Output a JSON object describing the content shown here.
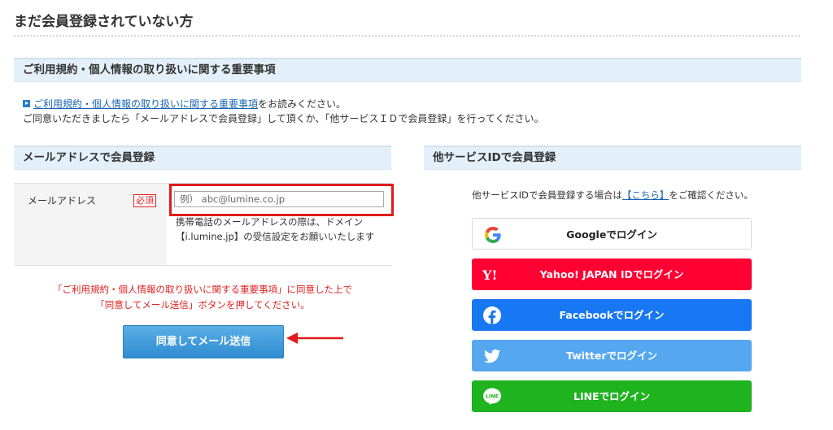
{
  "page_title": "まだ会員登録されていない方",
  "notice": {
    "heading": "ご利用規約・個人情報の取り扱いに関する重要事項",
    "link_text": "ご利用規約・個人情報の取り扱いに関する重要事項",
    "line1_suffix": "をお読みください。",
    "line2": "ご同意いただきましたら「メールアドレスで会員登録」して頂くか、「他サービスＩＤで会員登録」を行ってください。"
  },
  "mail_section": {
    "heading": "メールアドレスで会員登録",
    "field_label": "メールアドレス",
    "required_label": "必須",
    "input_value": "",
    "input_placeholder": "例） abc@lumine.co.jp",
    "note": "携帯電話のメールアドレスの際は、ドメイン【i.lumine.jp】の受信設定をお願いいたします",
    "agree_line1": "「ご利用規約・個人情報の取り扱いに関する重要事項」に同意した上で",
    "agree_line2": "「同意してメール送信」ボタンを押してください。",
    "submit_label": "同意してメール送信"
  },
  "other_section": {
    "heading": "他サービスIDで会員登録",
    "desc_prefix": "他サービスIDで会員登録する場合は",
    "desc_link": "【こちら】",
    "desc_suffix": "をご確認ください。",
    "buttons": [
      {
        "label": "Googleでログイン",
        "icon": "google-icon",
        "color": "#ffffff"
      },
      {
        "label": "Yahoo! JAPAN IDでログイン",
        "icon": "yahoo-icon",
        "color": "#ff0033"
      },
      {
        "label": "Facebookでログイン",
        "icon": "facebook-icon",
        "color": "#1877f2"
      },
      {
        "label": "Twitterでログイン",
        "icon": "twitter-icon",
        "color": "#55a8ef"
      },
      {
        "label": "LINEでログイン",
        "icon": "line-icon",
        "color": "#1fb31f"
      }
    ]
  },
  "colors": {
    "accent_red": "#e02020",
    "link_blue": "#1a66b3",
    "section_bg": "#e3f0f9"
  }
}
